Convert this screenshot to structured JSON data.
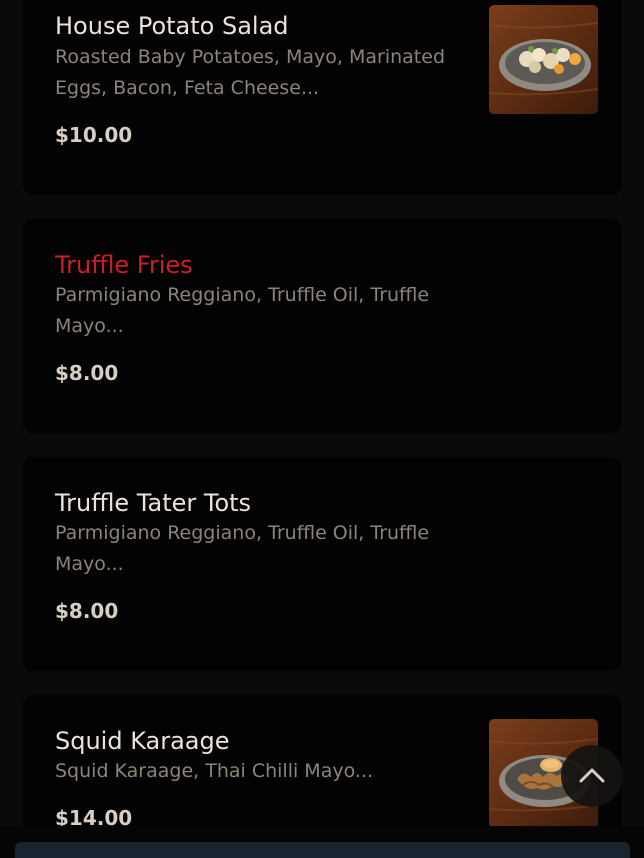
{
  "menu": {
    "items": [
      {
        "title": "House Potato Salad",
        "description": "Roasted Baby Potatoes, Mayo, Marinated Eggs, Bacon, Feta Cheese...",
        "price": "$10.00",
        "has_image": true,
        "image_icon": "potato-salad-dish"
      },
      {
        "title": "Truffle Fries",
        "description": "Parmigiano Reggiano, Truffle Oil, Truffle Mayo...",
        "price": "$8.00",
        "has_image": false
      },
      {
        "title": "Truffle Tater Tots",
        "description": "Parmigiano Reggiano, Truffle Oil, Truffle Mayo...",
        "price": "$8.00",
        "has_image": false
      },
      {
        "title": "Squid Karaage",
        "description": "Squid Karaage, Thai Chilli Mayo...",
        "price": "$14.00",
        "has_image": true,
        "image_icon": "squid-karaage-dish"
      }
    ]
  },
  "scroll_top": {
    "icon": "chevron-up-icon"
  },
  "colors": {
    "background": "#0b0a09",
    "card": "#030303",
    "title": "#ece3d8",
    "title_highlight": "#cd1e24",
    "description": "#8c8379",
    "price": "#d8cfc4",
    "bottom_bar": "#1a2330"
  }
}
